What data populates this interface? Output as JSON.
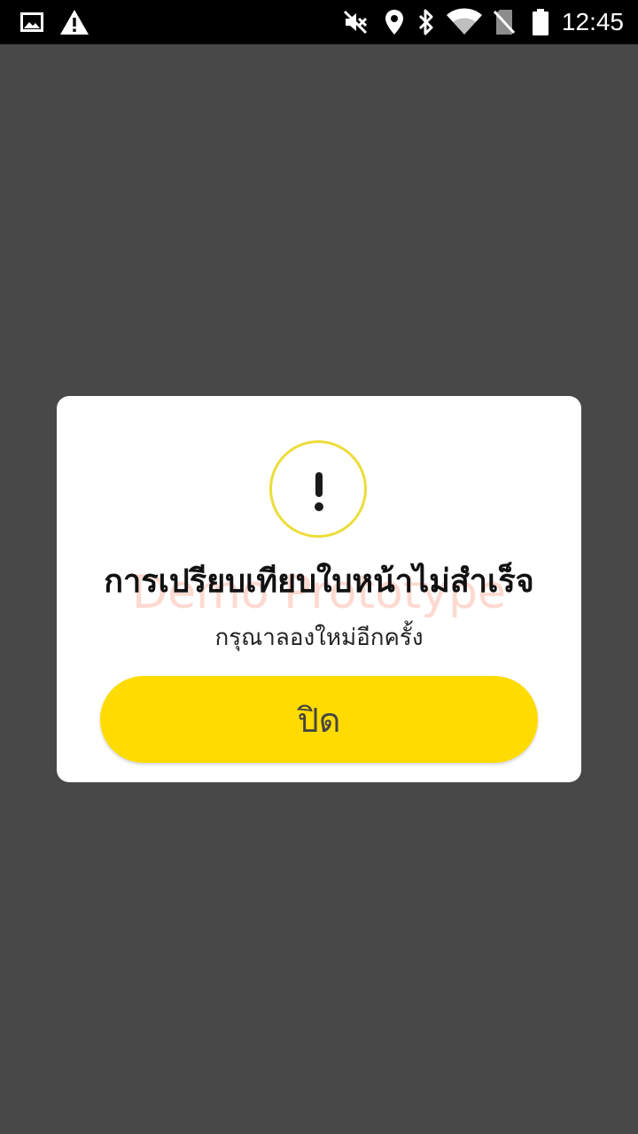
{
  "status_bar": {
    "time": "12:45",
    "icons": [
      "image-icon",
      "warning-icon",
      "mute-icon",
      "location-icon",
      "bluetooth-icon",
      "wifi-icon",
      "no-sim-icon",
      "battery-icon"
    ]
  },
  "dialog": {
    "icon": "exclamation-icon",
    "accent_color": "#ECDD3A",
    "watermark": "Demo Prototype",
    "title": "การเปรียบเทียบใบหน้าไม่สำเร็จ",
    "subtitle": "กรุณาลองใหม่อีกครั้ง",
    "close_label": "ปิด",
    "button_color": "#FFDB00"
  }
}
